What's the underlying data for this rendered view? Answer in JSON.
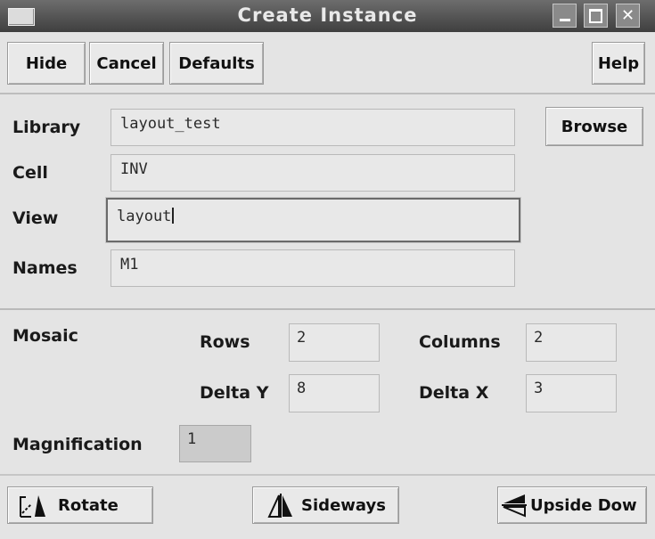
{
  "window": {
    "title": "Create Instance"
  },
  "toolbar": {
    "hide_label": "Hide",
    "cancel_label": "Cancel",
    "defaults_label": "Defaults",
    "help_label": "Help"
  },
  "form": {
    "library_label": "Library",
    "library_value": "layout_test",
    "browse_label": "Browse",
    "cell_label": "Cell",
    "cell_value": "INV",
    "view_label": "View",
    "view_value": "layout",
    "names_label": "Names",
    "names_value": "M1"
  },
  "mosaic": {
    "label": "Mosaic",
    "rows_label": "Rows",
    "rows_value": "2",
    "columns_label": "Columns",
    "columns_value": "2",
    "delta_y_label": "Delta Y",
    "delta_y_value": "8",
    "delta_x_label": "Delta X",
    "delta_x_value": "3"
  },
  "magnification": {
    "label": "Magnification",
    "value": "1"
  },
  "transforms": {
    "rotate_label": "Rotate",
    "sideways_label": "Sideways",
    "upside_down_label": "Upside Dow"
  },
  "icons": {
    "rotate": "rotate-icon",
    "sideways": "mirror-sideways-icon",
    "upside_down": "flip-upside-down-icon"
  }
}
